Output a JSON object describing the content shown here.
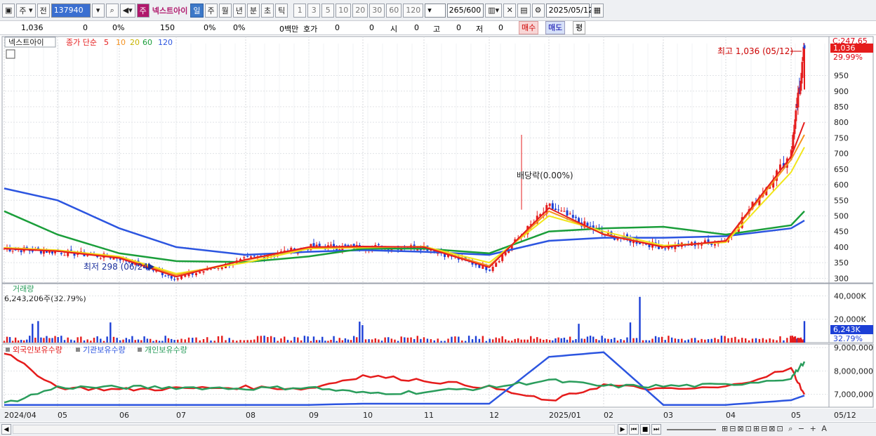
{
  "toolbar": {
    "period_label": "주",
    "prev_label": "전",
    "code": "137940",
    "name_badge": "주",
    "stock_name": "넥스트아이",
    "intervals": [
      "일",
      "주",
      "월",
      "년",
      "분",
      "초",
      "틱"
    ],
    "active_interval": "일",
    "nums": [
      "1",
      "3",
      "5",
      "10",
      "20",
      "30",
      "60",
      "120"
    ],
    "count_value": "265",
    "count_max": "/600",
    "date": "2025/05/12"
  },
  "infobar": {
    "price": "1,036",
    "change": "0",
    "change_pct": "0%",
    "volume": "150",
    "vol_pct1": "0%",
    "vol_pct2": "0%",
    "amount": "0백만",
    "hoga_label": "호가",
    "hoga_value": "0",
    "hoga_value2": "0",
    "open_label": "시",
    "open_value": "0",
    "high_label": "고",
    "high_value": "0",
    "low_label": "저",
    "low_value": "0",
    "buy_label": "매수",
    "sell_label": "매도",
    "avg_label": "평"
  },
  "colors": {
    "up": "#e51c1c",
    "down": "#1c3fd6",
    "ma5": "#e51c1c",
    "ma10": "#f5921f",
    "ma20": "#f2e61a",
    "ma60": "#1a9e3a",
    "ma120": "#2c55e0",
    "foreign": "#e51c1c",
    "institution": "#2c55e0",
    "individual": "#2a9d5c"
  },
  "price_pane": {
    "stock_label": "넥스트아이",
    "ma_title": "종가 단순",
    "ma_labels": [
      "5",
      "10",
      "20",
      "60",
      "120"
    ],
    "top_right_value": "C:247.65",
    "current_tag": "1,036",
    "current_pct": "29.99%",
    "high_note": "최고 1,036 (05/12)",
    "low_note": "최저 298 (06/24)",
    "dividend_note": "배당락(0.00%)",
    "y_ticks": [
      950,
      900,
      850,
      800,
      750,
      700,
      650,
      600,
      550,
      500,
      450,
      400,
      350,
      300
    ]
  },
  "volume_pane": {
    "title": "거래량",
    "value_text": "6,243,206주(32.79%)",
    "y_ticks": [
      "40,000K",
      "20,000K"
    ],
    "current_tag": "6,243K",
    "current_pct": "32.79%"
  },
  "holdings_pane": {
    "labels": [
      "외국인보유수량",
      "기관보유수량",
      "개인보유수량"
    ],
    "y_ticks": [
      "9,000,000",
      "8,000,000",
      "7,000,000"
    ]
  },
  "x_axis": {
    "labels": [
      "2024/04",
      "05",
      "06",
      "07",
      "08",
      "09",
      "10",
      "11",
      "12",
      "2025/01",
      "02",
      "03",
      "04",
      "05"
    ],
    "right_label": "05/12"
  },
  "chart_data": {
    "type": "candlestick",
    "title": "",
    "xlabel": "",
    "ylabel": "",
    "ylim": [
      285,
      1075
    ],
    "x": [
      "2024/04",
      "05",
      "06",
      "07",
      "08",
      "09",
      "10",
      "11",
      "12",
      "2025/01",
      "02",
      "03",
      "04",
      "05",
      "05/12"
    ],
    "close": [
      395,
      385,
      365,
      300,
      360,
      400,
      400,
      400,
      330,
      530,
      440,
      400,
      420,
      700,
      1036
    ],
    "volume_ylim": [
      0,
      48000
    ],
    "volume_unit": "K",
    "holdings_ylim": [
      6450000,
      9150000
    ],
    "series": [
      {
        "name": "종가 단순 5",
        "values": [
          395,
          387,
          365,
          305,
          360,
          400,
          402,
          400,
          335,
          525,
          440,
          400,
          420,
          690,
          800
        ]
      },
      {
        "name": "10",
        "values": [
          396,
          388,
          367,
          310,
          358,
          398,
          400,
          401,
          340,
          515,
          442,
          401,
          418,
          680,
          760
        ]
      },
      {
        "name": "20",
        "values": [
          398,
          390,
          370,
          315,
          350,
          395,
          398,
          402,
          350,
          500,
          450,
          405,
          415,
          640,
          720
        ]
      },
      {
        "name": "60",
        "values": [
          515,
          440,
          380,
          355,
          352,
          370,
          395,
          395,
          380,
          450,
          460,
          465,
          440,
          470,
          515
        ]
      },
      {
        "name": "120",
        "values": [
          588,
          550,
          460,
          400,
          375,
          385,
          390,
          385,
          375,
          420,
          430,
          430,
          435,
          460,
          485
        ]
      },
      {
        "name": "외국인보유수량",
        "values": [
          8800000,
          7300000,
          7200000,
          7250000,
          7300000,
          7250000,
          7800000,
          7600000,
          7300000,
          6700000,
          7400000,
          7200000,
          7300000,
          8100000,
          7000000
        ]
      },
      {
        "name": "기관보유수량",
        "values": [
          6550000,
          6550000,
          6550000,
          6550000,
          6550000,
          6550000,
          6600000,
          6600000,
          6600000,
          8600000,
          8800000,
          6550000,
          6550000,
          6750000,
          6950000
        ]
      },
      {
        "name": "개인보유수량",
        "values": [
          6600000,
          7300000,
          7300000,
          7300000,
          7250000,
          7300000,
          7050000,
          7100000,
          7300000,
          7600000,
          7350000,
          7350000,
          7400000,
          7700000,
          8400000
        ]
      }
    ]
  }
}
